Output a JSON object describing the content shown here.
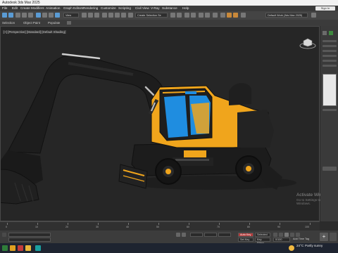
{
  "window": {
    "title": "Autodesk 3ds Max 2025"
  },
  "menu": {
    "items": [
      "File",
      "Edit",
      "Create",
      "Modifiers",
      "Animation",
      "Graph Editors",
      "Rendering",
      "Customize",
      "Scripting",
      "Civil View",
      "V-Ray",
      "Substance",
      "Help"
    ],
    "sign_in": "Sign In"
  },
  "toolbar": {
    "view_dropdown": "View",
    "selection_filter": "Create Selection Se",
    "workspace": "Default Work (3ds Max 2025)"
  },
  "ribbon": {
    "tabs": [
      "Selection",
      "Object Paint",
      "Populate"
    ]
  },
  "viewport": {
    "label": "[+] [Perspective] [Standard] [Default Shading]"
  },
  "windows_watermark": {
    "line1": "Activate Windows",
    "line2": "Go to Settings to activate Windows."
  },
  "timeline": {
    "ticks": [
      "0",
      "10",
      "20",
      "30",
      "40",
      "50",
      "60",
      "70",
      "80",
      "90",
      "100"
    ]
  },
  "status": {
    "auto_key": "Auto Key",
    "selected": "Selected",
    "set_key": "Set Key",
    "key_filters": "Key Filters...",
    "frame_rate": "0/100",
    "add_time_tag": "Add Time Tag"
  },
  "taskbar": {
    "weather_temp": "24°C",
    "weather_desc": "Partly sunny"
  },
  "colors": {
    "excavator_yellow": "#f0a51c",
    "excavator_black": "#1f1f1f",
    "glass_blue": "#1f8de0",
    "viewport_bg": "#262626"
  }
}
